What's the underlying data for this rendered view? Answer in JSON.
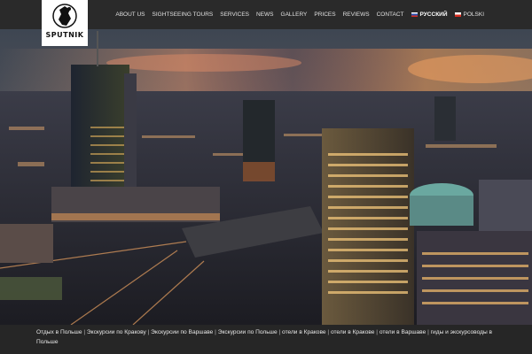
{
  "logo": {
    "text": "SPUTNIK"
  },
  "nav": {
    "items": [
      {
        "label": "ABOUT US"
      },
      {
        "label": "SIGHTSEEING TOURS"
      },
      {
        "label": "SERVICES"
      },
      {
        "label": "NEWS"
      },
      {
        "label": "GALLERY"
      },
      {
        "label": "PRICES"
      },
      {
        "label": "REVIEWS"
      },
      {
        "label": "CONTACT"
      }
    ],
    "languages": [
      {
        "label": "РУССКИЙ",
        "flag": "ru-flag-icon"
      },
      {
        "label": "POLSKI",
        "flag": "pl-flag-icon"
      }
    ]
  },
  "footer": {
    "links": [
      "Отдых в Польше",
      "Экскурсии по Кракову",
      "Экскурсии по Варшаве",
      "Экскурсии по Польше",
      "отели в Кракове",
      "отели в Кракове",
      "отели в Варшаве",
      "гиды и экскурсоводы в Польше"
    ]
  },
  "colors": {
    "bar": "#2a2a2a",
    "footer": "#262626",
    "sky_glow": "#e9946a"
  }
}
